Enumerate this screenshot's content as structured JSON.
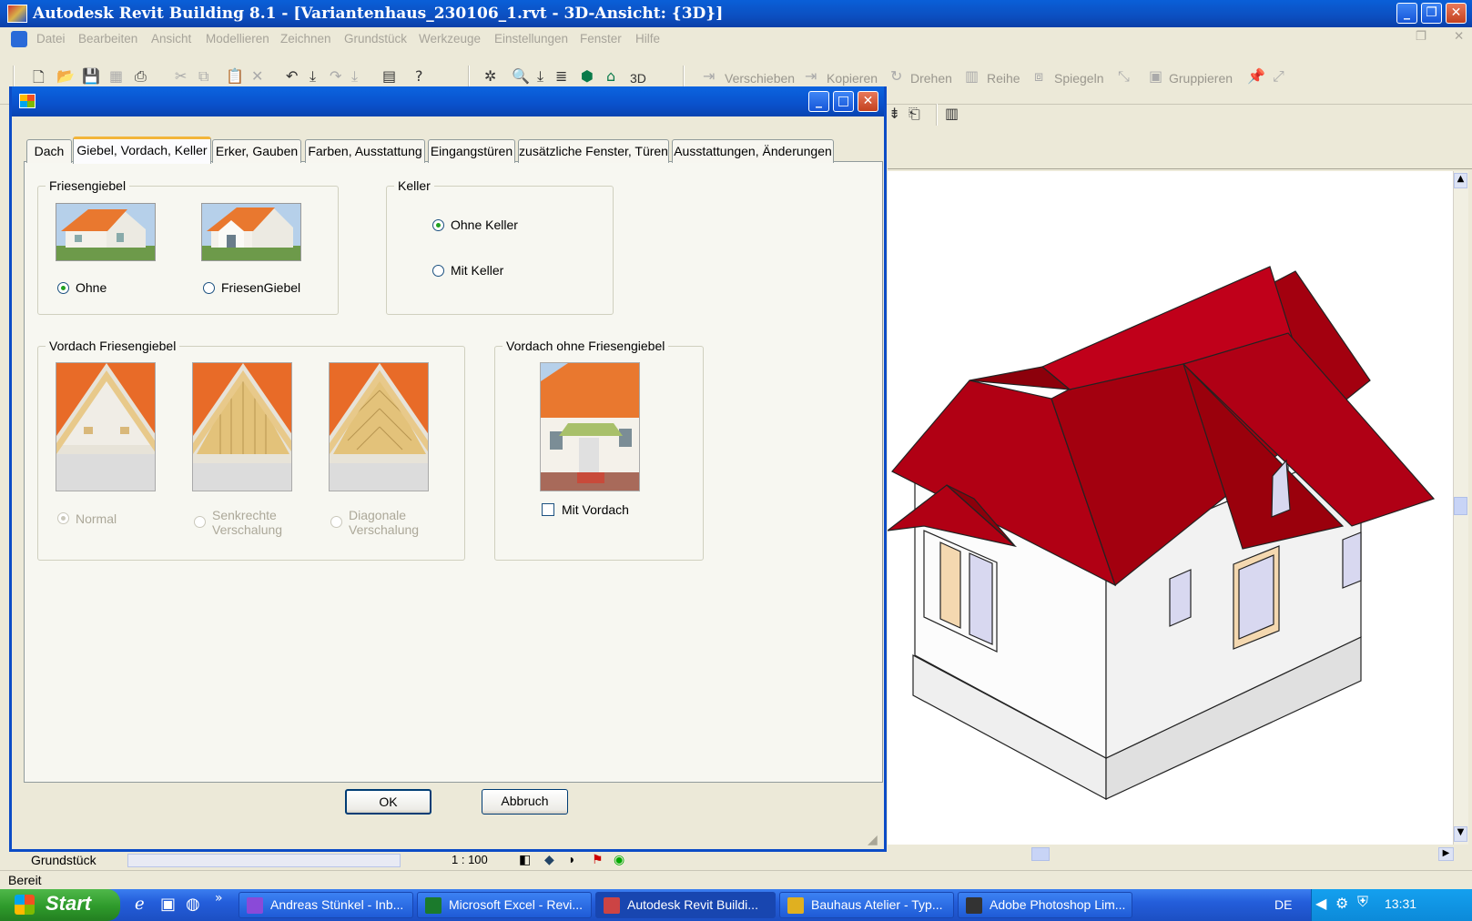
{
  "app": {
    "title": "Autodesk Revit Building 8.1 - [Variantenhaus_230106_1.rvt - 3D-Ansicht: {3D}]"
  },
  "menu": [
    "Datei",
    "Bearbeiten",
    "Ansicht",
    "Modellieren",
    "Zeichnen",
    "Grundstück",
    "Werkzeuge",
    "Einstellungen",
    "Fenster",
    "Hilfe"
  ],
  "toolbar": {
    "view3d": "3D",
    "verschieben": "Verschieben",
    "kopieren": "Kopieren",
    "drehen": "Drehen",
    "reihe": "Reihe",
    "spiegeln": "Spiegeln",
    "gruppieren": "Gruppieren"
  },
  "dialog": {
    "tabs": [
      "Dach",
      "Giebel, Vordach, Keller",
      "Erker, Gauben",
      "Farben, Ausstattung",
      "Eingangstüren",
      "zusätzliche Fenster, Türen",
      "Ausstattungen, Änderungen"
    ],
    "selected_tab": "Giebel, Vordach, Keller",
    "friesengiebel": {
      "legend": "Friesengiebel",
      "options": [
        "Ohne",
        "FriesenGiebel"
      ],
      "selected": "Ohne"
    },
    "keller": {
      "legend": "Keller",
      "options": [
        "Ohne Keller",
        "Mit Keller"
      ],
      "selected": "Ohne Keller"
    },
    "vordach_friesengiebel": {
      "legend": "Vordach Friesengiebel",
      "options": [
        "Normal",
        "Senkrechte Verschalung",
        "Diagonale Verschalung"
      ],
      "opt_lines": [
        [
          "Normal"
        ],
        [
          "Senkrechte",
          "Verschalung"
        ],
        [
          "Diagonale",
          "Verschalung"
        ]
      ],
      "selected": "Normal",
      "disabled": true
    },
    "vordach_ohne": {
      "legend": "Vordach ohne Friesengiebel",
      "checkbox": "Mit Vordach",
      "checked": false
    },
    "ok": "OK",
    "cancel": "Abbruch"
  },
  "bottom": {
    "grundstueck": "Grundstück",
    "scale": "1 : 100"
  },
  "status": "Bereit",
  "taskbar": {
    "start": "Start",
    "tasks": [
      "Andreas Stünkel - Inb...",
      "Microsoft Excel - Revi...",
      "Autodesk Revit Buildi...",
      "Bauhaus Atelier - Typ...",
      "Adobe Photoshop Lim..."
    ],
    "lang": "DE",
    "time": "13:31"
  },
  "colors": {
    "roof": "#a3000f",
    "xp_blue": "#0a51cc",
    "tab_accent": "#f3b53a"
  }
}
